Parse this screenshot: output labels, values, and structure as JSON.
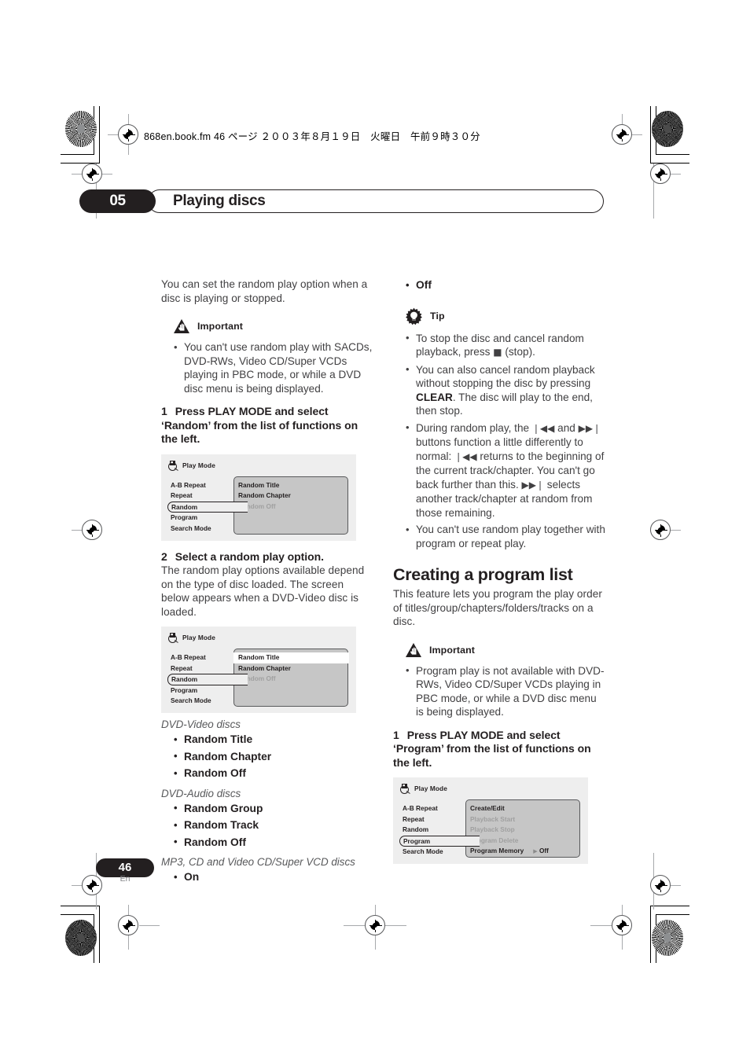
{
  "file_header": {
    "text": "868en.book.fm  46 ページ  ２００３年８月１９日　火曜日　午前９時３０分"
  },
  "chapter": {
    "number": "05",
    "title": "Playing discs"
  },
  "left_column": {
    "intro": "You can set the random play option when a disc is playing or stopped.",
    "important_label": "Important",
    "important_bullets": [
      "You can't use random play with SACDs, DVD-RWs, Video CD/Super VCDs playing in PBC mode, or while a DVD disc menu is being displayed."
    ],
    "step1_num": "1",
    "step1_text": "Press PLAY MODE and select ‘Random’ from the list of functions on the left.",
    "step2_num": "2",
    "step2_text": "Select a random play option.",
    "step2_body": "The random play options available depend on the type of disc loaded. The screen below appears when a DVD-Video disc is loaded.",
    "disc_groups": [
      {
        "heading": "DVD-Video discs",
        "options": [
          "Random Title",
          "Random Chapter",
          "Random Off"
        ]
      },
      {
        "heading": "DVD-Audio discs",
        "options": [
          "Random Group",
          "Random Track",
          "Random Off"
        ]
      },
      {
        "heading": "MP3, CD and Video CD/Super VCD discs",
        "options": [
          "On"
        ]
      }
    ]
  },
  "right_column": {
    "continued_options": [
      "Off"
    ],
    "tip_label": "Tip",
    "tip_bullets": [
      {
        "parts": [
          {
            "text": "To stop the disc and cancel random playback, press ",
            "style": "normal"
          },
          {
            "text": "■",
            "style": "glyph"
          },
          {
            "text": " (stop).",
            "style": "normal"
          }
        ]
      },
      {
        "parts": [
          {
            "text": "You can also cancel random playback without stopping the disc by pressing ",
            "style": "normal"
          },
          {
            "text": "CLEAR",
            "style": "bold"
          },
          {
            "text": ". The disc will play to the end, then stop.",
            "style": "normal"
          }
        ]
      },
      {
        "parts": [
          {
            "text": "During random play, the ",
            "style": "normal"
          },
          {
            "text": "❘◀◀",
            "style": "glyph"
          },
          {
            "text": " and ",
            "style": "normal"
          },
          {
            "text": "▶▶❘",
            "style": "glyph"
          },
          {
            "text": " buttons function a little differently to normal: ",
            "style": "normal"
          },
          {
            "text": "❘◀◀",
            "style": "glyph"
          },
          {
            "text": " returns to the beginning of the current track/chapter. You can't go back further than this. ",
            "style": "normal"
          },
          {
            "text": "▶▶❘",
            "style": "glyph"
          },
          {
            "text": " selects another track/chapter at random from those remaining.",
            "style": "normal"
          }
        ]
      },
      {
        "parts": [
          {
            "text": "You can't use random play together with program or repeat play.",
            "style": "normal"
          }
        ]
      }
    ],
    "section_title": "Creating a program list",
    "section_body": "This feature lets you program the play order of titles/group/chapters/folders/tracks on a disc.",
    "important_label": "Important",
    "important_bullets": [
      "Program play is not available with DVD-RWs, Video CD/Super VCDs playing in PBC mode, or while a DVD disc menu is being displayed."
    ],
    "step1_num": "1",
    "step1_text": "Press PLAY MODE and select ‘Program’ from the list of functions on the left."
  },
  "osd_screens": {
    "play_mode_label": "Play Mode",
    "random_unselected": {
      "menu": [
        "A-B Repeat",
        "Repeat",
        "Random",
        "Program",
        "Search Mode"
      ],
      "selected_menu_index": 2,
      "panel": [
        {
          "label": "Random Title",
          "dim": false,
          "highlight": false
        },
        {
          "label": "Random Chapter",
          "dim": false,
          "highlight": false
        },
        {
          "label": "Random Off",
          "dim": true,
          "highlight": false
        }
      ]
    },
    "random_selected": {
      "menu": [
        "A-B Repeat",
        "Repeat",
        "Random",
        "Program",
        "Search Mode"
      ],
      "selected_menu_index": 2,
      "panel": [
        {
          "label": "Random Title",
          "dim": false,
          "highlight": true
        },
        {
          "label": "Random Chapter",
          "dim": false,
          "highlight": false
        },
        {
          "label": "Random Off",
          "dim": true,
          "highlight": false
        }
      ]
    },
    "program": {
      "menu": [
        "A-B Repeat",
        "Repeat",
        "Random",
        "Program",
        "Search Mode"
      ],
      "selected_menu_index": 3,
      "panel": [
        {
          "label": "Create/Edit",
          "dim": false,
          "highlight": false
        },
        {
          "label": "Playback Start",
          "dim": true,
          "highlight": false
        },
        {
          "label": "Playback Stop",
          "dim": true,
          "highlight": false
        },
        {
          "label": "Program Delete",
          "dim": true,
          "highlight": false
        },
        {
          "label": "Program Memory",
          "dim": false,
          "highlight": false,
          "arrow": "▶",
          "value": "Off"
        }
      ]
    }
  },
  "footer": {
    "page_number": "46",
    "language": "En"
  },
  "colors": {
    "ink": "#231f20",
    "body_text": "#414042",
    "osd_bg": "#eeeeee",
    "osd_panel": "#c6c6c6"
  }
}
